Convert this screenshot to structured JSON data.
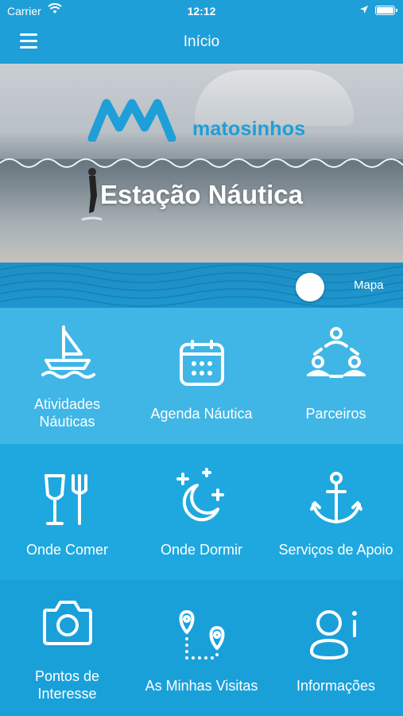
{
  "status_bar": {
    "carrier": "Carrier",
    "time": "12:12"
  },
  "nav": {
    "title": "Início"
  },
  "hero": {
    "brand": "matosinhos",
    "title": "Estação Náutica",
    "map_label": "Mapa"
  },
  "colors": {
    "primary": "#1e9fd8",
    "row1": "#40b6e6",
    "row2": "#1ea8df",
    "row3": "#1aa0d9"
  },
  "tiles": [
    {
      "icon": "sailboat-icon",
      "line1": "Atividades",
      "line2": "Náuticas"
    },
    {
      "icon": "calendar-icon",
      "line1": "Agenda Náutica",
      "line2": ""
    },
    {
      "icon": "partners-icon",
      "line1": "Parceiros",
      "line2": ""
    },
    {
      "icon": "glass-fork-icon",
      "line1": "Onde Comer",
      "line2": ""
    },
    {
      "icon": "moon-stars-icon",
      "line1": "Onde Dormir",
      "line2": ""
    },
    {
      "icon": "anchor-icon",
      "line1": "Serviços de Apoio",
      "line2": ""
    },
    {
      "icon": "camera-icon",
      "line1": "Pontos de",
      "line2": "Interesse"
    },
    {
      "icon": "route-pins-icon",
      "line1": "As Minhas Visitas",
      "line2": ""
    },
    {
      "icon": "info-user-icon",
      "line1": "Informações",
      "line2": ""
    }
  ]
}
